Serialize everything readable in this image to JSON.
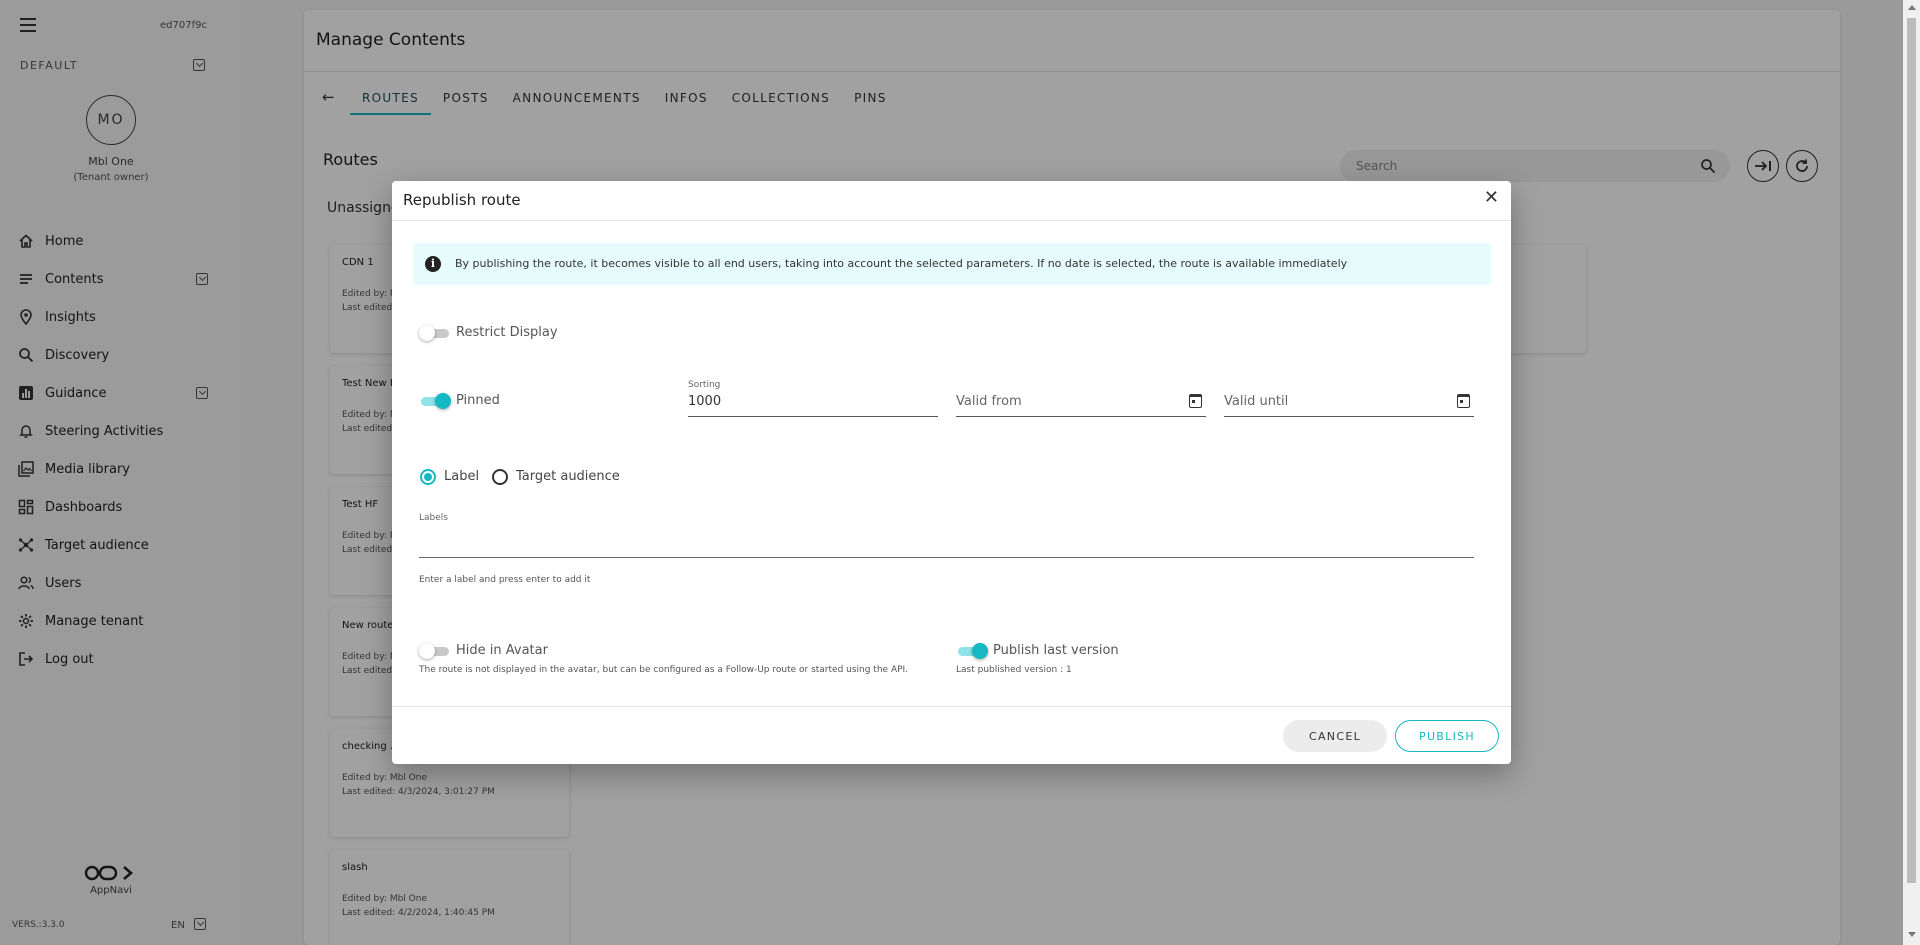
{
  "sidebar": {
    "tenant_id": "ed707f9c",
    "workspace": "DEFAULT",
    "avatar_initials": "MO",
    "user_name": "Mbl One",
    "user_role": "(Tenant owner)",
    "items": [
      {
        "label": "Home",
        "icon": "home-icon"
      },
      {
        "label": "Contents",
        "icon": "list-icon",
        "expandable": true
      },
      {
        "label": "Insights",
        "icon": "pin-icon"
      },
      {
        "label": "Discovery",
        "icon": "search-icon"
      },
      {
        "label": "Guidance",
        "icon": "bar-chart-icon",
        "expandable": true
      },
      {
        "label": "Steering Activities",
        "icon": "bell-icon"
      },
      {
        "label": "Media library",
        "icon": "media-icon"
      },
      {
        "label": "Dashboards",
        "icon": "dashboard-icon"
      },
      {
        "label": "Target audience",
        "icon": "network-icon"
      },
      {
        "label": "Users",
        "icon": "users-icon"
      },
      {
        "label": "Manage tenant",
        "icon": "gear-icon"
      },
      {
        "label": "Log out",
        "icon": "logout-icon"
      }
    ],
    "logo_text": "AppNavi",
    "version": "VERS.:3.3.0",
    "language": "EN"
  },
  "main": {
    "title": "Manage Contents",
    "tabs": [
      {
        "label": "ROUTES",
        "active": true
      },
      {
        "label": "POSTS"
      },
      {
        "label": "ANNOUNCEMENTS"
      },
      {
        "label": "INFOS"
      },
      {
        "label": "COLLECTIONS"
      },
      {
        "label": "PINS"
      }
    ],
    "section_title": "Routes",
    "search_placeholder": "Search",
    "group_title": "Unassigne",
    "cards": [
      {
        "title": "CDN 1",
        "line1": "Edited by: M",
        "line2": "Last edited:"
      },
      {
        "title": "Test New R",
        "line1": "Edited by: M",
        "line2": "Last edited:"
      },
      {
        "title": "Test HF",
        "line1": "Edited by: M",
        "line2": "Last edited:"
      },
      {
        "title": "New route",
        "line1": "Edited by: M",
        "line2": "Last edited:"
      },
      {
        "title": "checking ...",
        "line1": "Edited by: Mbl One",
        "line2": "Last edited: 4/3/2024, 3:01:27 PM"
      },
      {
        "title": "slash",
        "line1": "Edited by: Mbl One",
        "line2": "Last edited: 4/2/2024, 1:40:45 PM"
      }
    ]
  },
  "dialog": {
    "title": "Republish route",
    "info_text": "By publishing the route, it becomes visible to all end users, taking into account the selected parameters. If no date is selected, the route is available immediately",
    "restrict_display": {
      "label": "Restrict Display",
      "on": false
    },
    "pinned": {
      "label": "Pinned",
      "on": true
    },
    "sorting": {
      "label": "Sorting",
      "value": "1000"
    },
    "valid_from": {
      "placeholder": "Valid from"
    },
    "valid_until": {
      "placeholder": "Valid until"
    },
    "radio_label": "Label",
    "radio_target": "Target audience",
    "labels_field": {
      "label": "Labels",
      "helper": "Enter a label and press enter to add it"
    },
    "hide_in_avatar": {
      "label": "Hide in Avatar",
      "on": false,
      "helper": "The route is not displayed in the avatar, but can be configured as a Follow-Up route or started using the API."
    },
    "publish_last_version": {
      "label": "Publish last version",
      "on": true,
      "helper": "Last published version : 1"
    },
    "cancel_label": "CANCEL",
    "publish_label": "PUBLISH"
  },
  "colors": {
    "accent": "#16b8c3",
    "overlay": "rgba(0,0,0,0.37)"
  }
}
